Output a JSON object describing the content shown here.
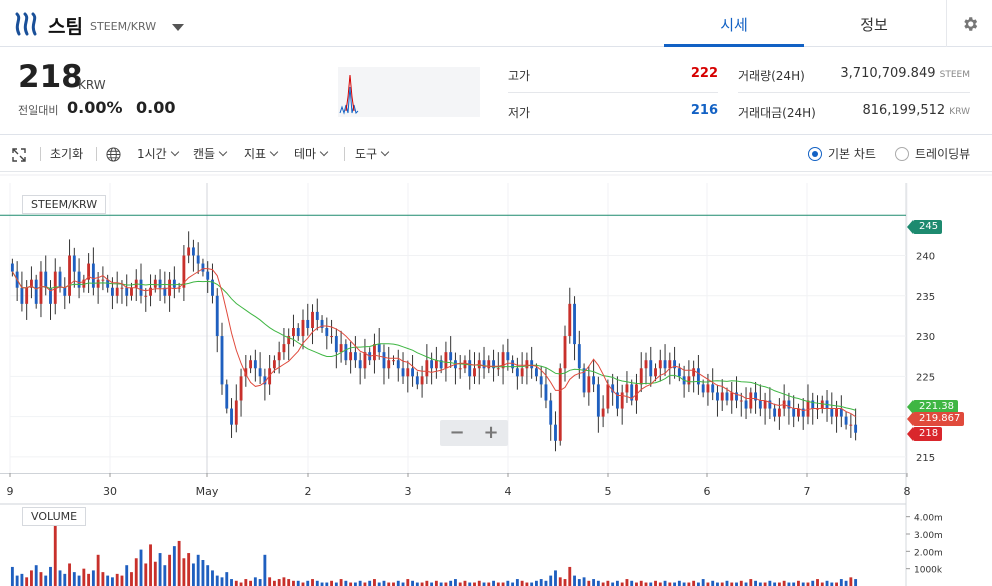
{
  "header": {
    "coin_name": "스팀",
    "pair": "STEEM/KRW",
    "tabs": [
      {
        "label": "시세",
        "active": true
      },
      {
        "label": "정보",
        "active": false
      }
    ]
  },
  "summary": {
    "price": "218",
    "price_unit": "KRW",
    "change_label": "전일대비",
    "change_pct": "0.00%",
    "change_amt": "0.00",
    "high_label": "고가",
    "high": "222",
    "low_label": "저가",
    "low": "216",
    "volume_label": "거래량(24H)",
    "volume": "3,710,709.849",
    "volume_unit": "STEEM",
    "amount_label": "거래대금(24H)",
    "amount": "816,199,512",
    "amount_unit": "KRW"
  },
  "toolbar": {
    "reset": "초기화",
    "interval": "1시간",
    "candle": "캔들",
    "indicator": "지표",
    "theme": "테마",
    "tools": "도구",
    "basic_chart": "기본 차트",
    "tradingview": "트레이딩뷰"
  },
  "chart_data": {
    "type": "candlestick",
    "title": "STEEM/KRW",
    "volume_title": "VOLUME",
    "x_ticks": [
      "9",
      "30",
      "May",
      "2",
      "3",
      "4",
      "5",
      "6",
      "7",
      "8"
    ],
    "y_ticks": [
      "240",
      "235",
      "230",
      "225",
      "220",
      "215"
    ],
    "ylim": [
      213,
      249
    ],
    "volume_ticks": [
      "4.00m",
      "3.00m",
      "2.00m",
      "1000k"
    ],
    "volume_ylim": [
      0,
      4500000
    ],
    "price_line": 245,
    "price_line_label": "245",
    "ma_long_label": "221.38",
    "ma_short_label": "219.867",
    "last_label": "218",
    "last_price": 218,
    "ma_long_last": 221.38,
    "ma_short_last": 219.867,
    "colors": {
      "up": "#c8302b",
      "down": "#1f5fbf",
      "ma_long": "#3fb643",
      "ma_short": "#e04a3c",
      "line": "#1d8a6f"
    },
    "close_path": [
      238,
      236,
      234,
      236,
      237,
      234,
      238,
      236,
      234,
      238,
      236,
      235,
      240,
      238,
      236,
      237,
      239,
      236,
      237,
      237,
      236,
      235,
      236,
      236,
      235,
      236,
      237,
      235,
      235,
      236,
      237,
      236,
      235,
      237,
      236,
      236,
      240,
      241,
      240,
      239,
      238,
      237,
      235,
      230,
      224,
      221,
      219,
      222,
      225,
      226,
      227,
      226,
      225,
      224,
      226,
      227,
      228,
      229,
      230,
      231,
      230,
      232,
      231,
      233,
      232,
      231,
      230,
      230,
      228,
      229,
      227,
      228,
      227,
      226,
      228,
      227,
      229,
      228,
      226,
      227,
      227,
      226,
      225,
      226,
      225,
      224,
      225,
      227,
      226,
      227,
      226,
      228,
      227,
      226,
      226,
      227,
      225,
      226,
      227,
      226,
      227,
      226,
      226,
      228,
      227,
      226,
      225,
      226,
      227,
      226,
      225,
      224,
      222,
      219,
      217,
      226,
      230,
      234,
      229,
      226,
      223,
      225,
      224,
      220,
      221,
      224,
      223,
      221,
      223,
      224,
      222,
      224,
      226,
      227,
      225,
      226,
      227,
      226,
      227,
      226,
      225,
      224,
      225,
      226,
      224,
      223,
      224,
      223,
      222,
      223,
      222,
      223,
      222,
      222,
      221,
      223,
      222,
      221,
      222,
      221,
      220,
      221,
      222,
      221,
      220,
      221,
      220,
      222,
      221,
      221,
      222,
      221,
      220,
      221,
      220,
      219,
      219,
      218
    ],
    "volumes": [
      1.1,
      0.6,
      0.7,
      0.5,
      0.9,
      1.2,
      0.8,
      0.6,
      1.1,
      4.5,
      0.9,
      0.7,
      1.3,
      0.8,
      0.6,
      1.0,
      0.7,
      0.9,
      1.8,
      0.8,
      0.6,
      0.5,
      0.7,
      0.6,
      1.2,
      0.8,
      1.6,
      2.1,
      1.3,
      2.4,
      1.4,
      1.9,
      1.2,
      1.8,
      2.3,
      2.6,
      1.6,
      1.9,
      1.3,
      1.8,
      1.5,
      1.2,
      0.9,
      0.6,
      0.5,
      0.8,
      0.4,
      0.3,
      0.2,
      0.4,
      0.3,
      0.5,
      0.4,
      1.8,
      0.5,
      0.3,
      0.4,
      0.5,
      0.4,
      0.3,
      0.3,
      0.2,
      0.3,
      0.4,
      0.3,
      0.2,
      0.2,
      0.3,
      0.2,
      0.4,
      0.3,
      0.2,
      0.2,
      0.3,
      0.2,
      0.3,
      0.4,
      0.2,
      0.3,
      0.2,
      0.2,
      0.3,
      0.2,
      0.4,
      0.3,
      0.2,
      0.2,
      0.3,
      0.2,
      0.3,
      0.2,
      0.2,
      0.3,
      0.4,
      0.2,
      0.3,
      0.2,
      0.2,
      0.3,
      0.2,
      0.2,
      0.3,
      0.2,
      0.2,
      0.3,
      0.2,
      0.4,
      0.3,
      0.2,
      0.2,
      0.3,
      0.4,
      0.3,
      0.6,
      0.9,
      0.5,
      0.4,
      1.1,
      0.6,
      0.4,
      0.5,
      0.3,
      0.4,
      0.3,
      0.2,
      0.3,
      0.2,
      0.3,
      0.2,
      0.4,
      0.3,
      0.2,
      0.3,
      0.2,
      0.2,
      0.3,
      0.2,
      0.3,
      0.2,
      0.2,
      0.3,
      0.2,
      0.2,
      0.3,
      0.2,
      0.4,
      0.2,
      0.3,
      0.2,
      0.2,
      0.3,
      0.2,
      0.2,
      0.3,
      0.2,
      0.4,
      0.3,
      0.2,
      0.2,
      0.3,
      0.2,
      0.2,
      0.3,
      0.2,
      0.2,
      0.3,
      0.2,
      0.2,
      0.3,
      0.4,
      0.2,
      0.3,
      0.2,
      0.2,
      0.4,
      0.3,
      0.5,
      0.4
    ]
  }
}
